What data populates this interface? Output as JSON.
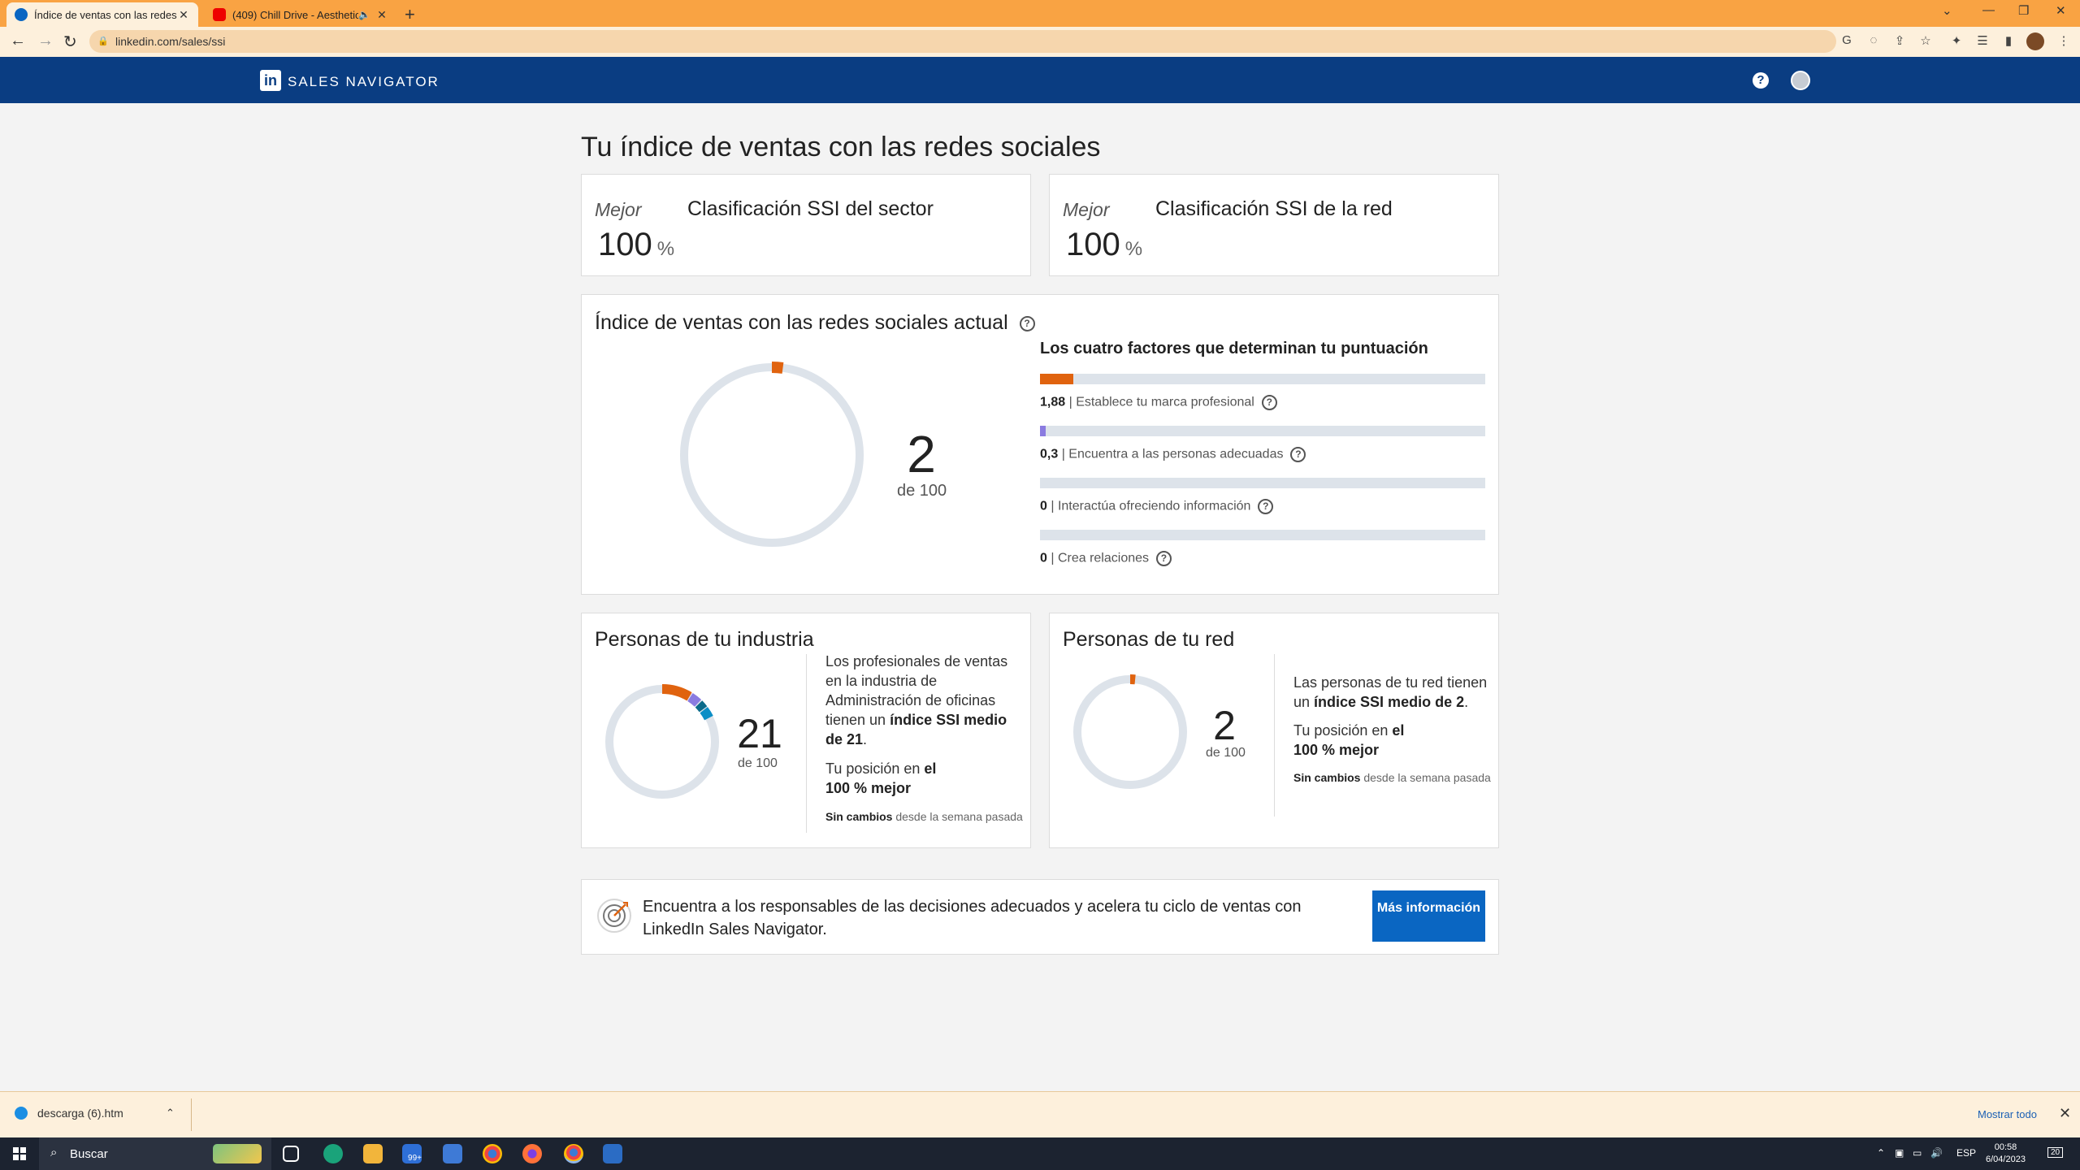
{
  "browser": {
    "tabs": [
      {
        "title": "Índice de ventas con las redes so",
        "active": true
      },
      {
        "title": "(409) Chill Drive - Aesthetic",
        "active": false
      }
    ],
    "url": "linkedin.com/sales/ssi"
  },
  "header": {
    "product": "SALES NAVIGATOR",
    "logo_text": "in"
  },
  "page": {
    "title": "Tu índice de ventas con las redes sociales"
  },
  "rank_cards": [
    {
      "prefix": "Mejor",
      "value": "100",
      "unit": "%",
      "label": "Clasificación SSI del sector"
    },
    {
      "prefix": "Mejor",
      "value": "100",
      "unit": "%",
      "label": "Clasificación SSI de la red"
    }
  ],
  "current_ssi": {
    "title": "Índice de ventas con las redes sociales actual",
    "score": "2",
    "of": "de 100",
    "factors_title": "Los cuatro factores que determinan tu puntuación",
    "factors": [
      {
        "value": "1,88",
        "label": "Establece tu marca profesional",
        "fraction": 0.075,
        "color": "#e0630f"
      },
      {
        "value": "0,3",
        "label": "Encuentra a las personas adecuadas",
        "fraction": 0.012,
        "color": "#8a7be0"
      },
      {
        "value": "0",
        "label": "Interactúa ofreciendo información",
        "fraction": 0,
        "color": "#0b8ec6"
      },
      {
        "value": "0",
        "label": "Crea relaciones",
        "fraction": 0,
        "color": "#0b6b8a"
      }
    ]
  },
  "industry": {
    "title": "Personas de tu industria",
    "score": "21",
    "of": "de 100",
    "text1_a": "Los profesionales de ventas en la industria de Administración de oficinas tienen un ",
    "text1_b": "índice SSI medio de 21",
    "text1_c": ".",
    "text2_a": "Tu posición en ",
    "text2_b": "el 100 % mejor",
    "change_a": "Sin cambios",
    "change_b": " desde la semana pasada"
  },
  "network": {
    "title": "Personas de tu red",
    "score": "2",
    "of": "de 100",
    "text1_a": "Las personas de tu red tienen un ",
    "text1_b": "índice SSI medio de 2",
    "text1_c": ".",
    "text2_a": "Tu posición en ",
    "text2_b": "el 100 % mejor",
    "change_a": "Sin cambios",
    "change_b": " desde la semana pasada"
  },
  "promo": {
    "text": "Encuentra a los responsables de las decisiones adecuados y acelera tu ciclo de ventas con LinkedIn Sales Navigator.",
    "button": "Más información"
  },
  "downloads": {
    "file": "descarga (6).htm",
    "show_all": "Mostrar todo"
  },
  "taskbar": {
    "search": "Buscar",
    "lang": "ESP",
    "time": "00:58",
    "date": "6/04/2023",
    "badge": "99+",
    "notif": "20"
  }
}
